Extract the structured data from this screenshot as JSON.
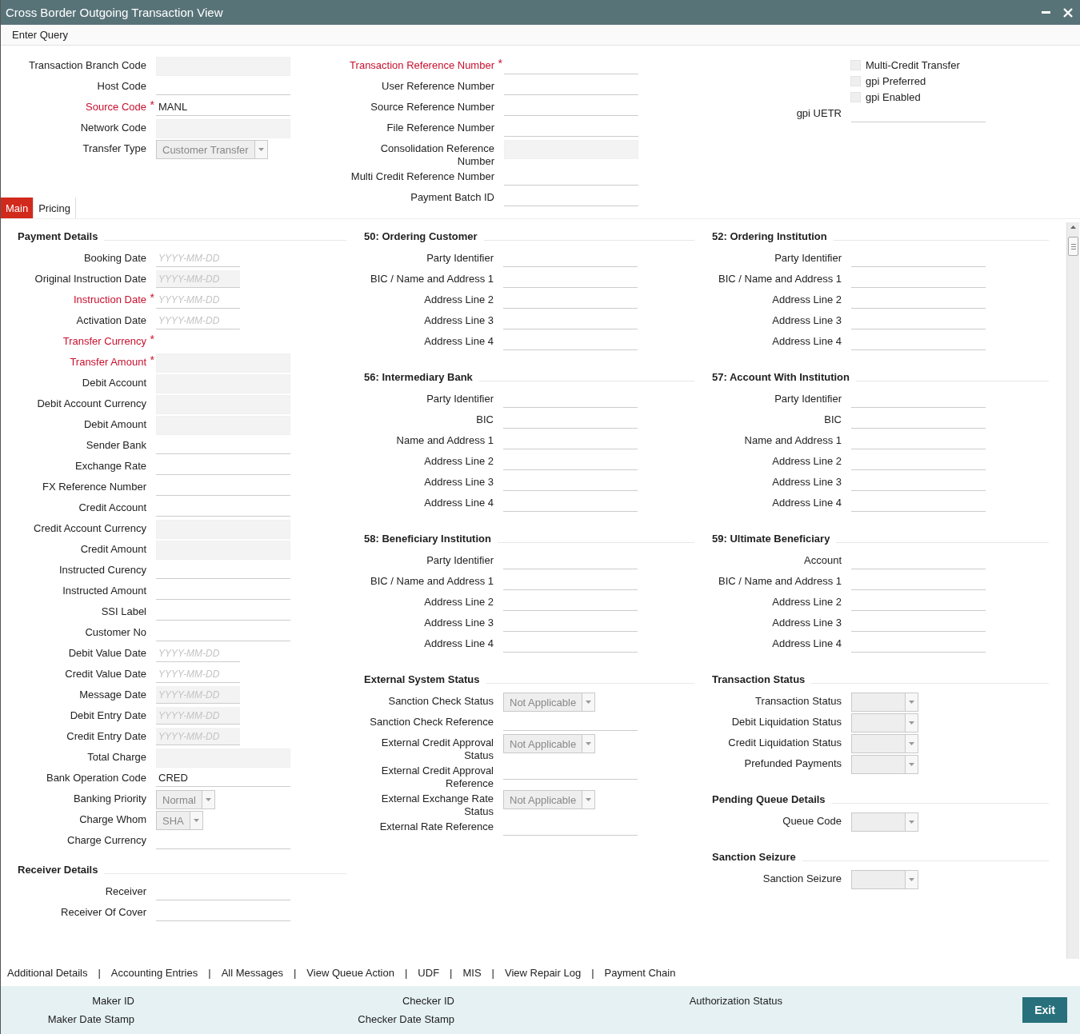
{
  "window": {
    "title": "Cross Border Outgoing Transaction View"
  },
  "menu": [
    "Enter Query"
  ],
  "header": {
    "left": [
      {
        "label": "Transaction Branch Code",
        "kind": "locked"
      },
      {
        "label": "Host Code",
        "kind": "text"
      },
      {
        "label": "Source Code",
        "kind": "text",
        "value": "MANL",
        "required_mark": "*"
      },
      {
        "label": "Network Code",
        "kind": "locked"
      },
      {
        "label": "Transfer Type",
        "kind": "select",
        "value": "Customer Transfer"
      }
    ],
    "middle": [
      {
        "label": "Transaction Reference Number",
        "kind": "text",
        "required_mark": "*"
      },
      {
        "label": "User Reference Number",
        "kind": "text"
      },
      {
        "label": "Source Reference Number",
        "kind": "text"
      },
      {
        "label": "File Reference Number",
        "kind": "text"
      },
      {
        "label": "Consolidation Reference Number",
        "kind": "locked"
      },
      {
        "label": "Multi Credit Reference Number",
        "kind": "text"
      },
      {
        "label": "Payment Batch ID",
        "kind": "text"
      }
    ],
    "checkboxes": [
      {
        "label": "Multi-Credit Transfer",
        "checked": false
      },
      {
        "label": "gpi Preferred",
        "checked": false
      },
      {
        "label": "gpi Enabled",
        "checked": false
      }
    ],
    "right": [
      {
        "label": "gpi UETR",
        "kind": "text"
      }
    ]
  },
  "tabs": [
    {
      "label": "Main",
      "selected": true
    },
    {
      "label": "Pricing",
      "selected": false
    }
  ],
  "columns": [
    [
      {
        "title": "Payment Details",
        "fields": [
          {
            "label": "Booking Date",
            "kind": "date",
            "placeholder": "YYYY-MM-DD"
          },
          {
            "label": "Original Instruction Date",
            "kind": "lockeddate",
            "placeholder": "YYYY-MM-DD"
          },
          {
            "label": "Instruction Date",
            "kind": "date",
            "placeholder": "YYYY-MM-DD",
            "required_mark": "*"
          },
          {
            "label": "Activation Date",
            "kind": "date",
            "placeholder": "YYYY-MM-DD"
          },
          {
            "label": "Transfer Currency",
            "kind": "blank",
            "required_mark": "*"
          },
          {
            "label": "Transfer Amount",
            "kind": "locked",
            "required_mark": "*"
          },
          {
            "label": "Debit Account",
            "kind": "locked"
          },
          {
            "label": "Debit Account Currency",
            "kind": "locked"
          },
          {
            "label": "Debit Amount",
            "kind": "locked"
          },
          {
            "label": "Sender Bank",
            "kind": "text"
          },
          {
            "label": "Exchange Rate",
            "kind": "text"
          },
          {
            "label": "FX Reference Number",
            "kind": "text"
          },
          {
            "label": "Credit Account",
            "kind": "text"
          },
          {
            "label": "Credit Account Currency",
            "kind": "locked"
          },
          {
            "label": "Credit Amount",
            "kind": "locked"
          },
          {
            "label": "Instructed Curency",
            "kind": "text"
          },
          {
            "label": "Instructed Amount",
            "kind": "text"
          },
          {
            "label": "SSI Label",
            "kind": "text"
          },
          {
            "label": "Customer No",
            "kind": "text"
          },
          {
            "label": "Debit Value Date",
            "kind": "date",
            "placeholder": "YYYY-MM-DD"
          },
          {
            "label": "Credit Value Date",
            "kind": "date",
            "placeholder": "YYYY-MM-DD"
          },
          {
            "label": "Message Date",
            "kind": "lockeddate",
            "placeholder": "YYYY-MM-DD"
          },
          {
            "label": "Debit Entry Date",
            "kind": "lockeddate",
            "placeholder": "YYYY-MM-DD"
          },
          {
            "label": "Credit Entry Date",
            "kind": "lockeddate",
            "placeholder": "YYYY-MM-DD"
          },
          {
            "label": "Total Charge",
            "kind": "locked"
          },
          {
            "label": "Bank Operation Code",
            "kind": "text",
            "value": "CRED"
          },
          {
            "label": "Banking Priority",
            "kind": "select",
            "value": "Normal"
          },
          {
            "label": "Charge Whom",
            "kind": "select",
            "value": "SHA"
          },
          {
            "label": "Charge Currency",
            "kind": "text"
          }
        ]
      },
      {
        "title": "Receiver Details",
        "fields": [
          {
            "label": "Receiver",
            "kind": "text"
          },
          {
            "label": "Receiver Of Cover",
            "kind": "text"
          }
        ]
      }
    ],
    [
      {
        "title": "50: Ordering Customer",
        "fields": [
          {
            "label": "Party Identifier",
            "kind": "text"
          },
          {
            "label": "BIC / Name and Address 1",
            "kind": "text"
          },
          {
            "label": "Address Line 2",
            "kind": "text"
          },
          {
            "label": "Address Line 3",
            "kind": "text"
          },
          {
            "label": "Address Line 4",
            "kind": "text"
          }
        ]
      },
      {
        "title": "56: Intermediary Bank",
        "fields": [
          {
            "label": "Party Identifier",
            "kind": "text"
          },
          {
            "label": "BIC",
            "kind": "text"
          },
          {
            "label": "Name and Address 1",
            "kind": "text"
          },
          {
            "label": "Address Line 2",
            "kind": "text"
          },
          {
            "label": "Address Line 3",
            "kind": "text"
          },
          {
            "label": "Address Line 4",
            "kind": "text"
          }
        ]
      },
      {
        "title": "58: Beneficiary Institution",
        "fields": [
          {
            "label": "Party Identifier",
            "kind": "text"
          },
          {
            "label": "BIC / Name and Address 1",
            "kind": "text"
          },
          {
            "label": "Address Line 2",
            "kind": "text"
          },
          {
            "label": "Address Line 3",
            "kind": "text"
          },
          {
            "label": "Address Line 4",
            "kind": "text"
          }
        ]
      },
      {
        "title": "External System Status",
        "fields": [
          {
            "label": "Sanction Check Status",
            "kind": "select",
            "value": "Not Applicable"
          },
          {
            "label": "Sanction Check Reference",
            "kind": "text"
          },
          {
            "label": "External Credit Approval Status",
            "kind": "select",
            "value": "Not Applicable"
          },
          {
            "label": "External Credit Approval Reference",
            "kind": "text"
          },
          {
            "label": "External Exchange Rate Status",
            "kind": "select",
            "value": "Not Applicable"
          },
          {
            "label": "External Rate Reference",
            "kind": "text"
          }
        ]
      }
    ],
    [
      {
        "title": "52: Ordering Institution",
        "fields": [
          {
            "label": "Party Identifier",
            "kind": "text"
          },
          {
            "label": "BIC / Name and Address 1",
            "kind": "text"
          },
          {
            "label": "Address Line 2",
            "kind": "text"
          },
          {
            "label": "Address Line 3",
            "kind": "text"
          },
          {
            "label": "Address Line 4",
            "kind": "text"
          }
        ]
      },
      {
        "title": "57: Account With Institution",
        "fields": [
          {
            "label": "Party Identifier",
            "kind": "text"
          },
          {
            "label": "BIC",
            "kind": "text"
          },
          {
            "label": "Name and Address 1",
            "kind": "text"
          },
          {
            "label": "Address Line 2",
            "kind": "text"
          },
          {
            "label": "Address Line 3",
            "kind": "text"
          },
          {
            "label": "Address Line 4",
            "kind": "text"
          }
        ]
      },
      {
        "title": "59: Ultimate Beneficiary",
        "fields": [
          {
            "label": "Account",
            "kind": "text"
          },
          {
            "label": "BIC / Name and Address 1",
            "kind": "text"
          },
          {
            "label": "Address Line 2",
            "kind": "text"
          },
          {
            "label": "Address Line 3",
            "kind": "text"
          },
          {
            "label": "Address Line 4",
            "kind": "text"
          }
        ]
      },
      {
        "title": "Transaction Status",
        "fields": [
          {
            "label": "Transaction Status",
            "kind": "select"
          },
          {
            "label": "Debit Liquidation Status",
            "kind": "select"
          },
          {
            "label": "Credit Liquidation Status",
            "kind": "select"
          },
          {
            "label": "Prefunded Payments",
            "kind": "select"
          }
        ]
      },
      {
        "title": "Pending Queue Details",
        "fields": [
          {
            "label": "Queue Code",
            "kind": "select"
          }
        ]
      },
      {
        "title": "Sanction Seizure",
        "fields": [
          {
            "label": "Sanction Seizure",
            "kind": "select"
          }
        ]
      }
    ]
  ],
  "links": {
    "separator": "|",
    "items": [
      "Additional Details",
      "Accounting Entries",
      "All Messages",
      "View Queue Action",
      "UDF",
      "MIS",
      "View Repair Log",
      "Payment Chain"
    ]
  },
  "audit": [
    [
      "Maker ID",
      "Maker Date Stamp"
    ],
    [
      "Checker ID",
      "Checker Date Stamp"
    ],
    [
      "Authorization Status"
    ]
  ],
  "exit": "Exit"
}
